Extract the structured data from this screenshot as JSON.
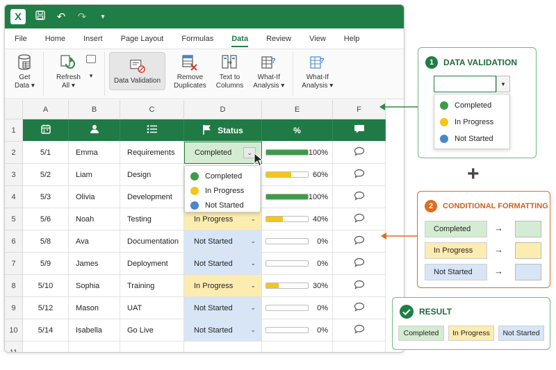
{
  "ribbon_tabs": [
    "File",
    "Home",
    "Insert",
    "Page Layout",
    "Formulas",
    "Data",
    "Review",
    "View",
    "Help"
  ],
  "active_tab": "Data",
  "ribbon": {
    "get_data": [
      "Get",
      "Data"
    ],
    "refresh": [
      "Refresh",
      "All"
    ],
    "data_validation": "Data Validation",
    "remove_duplicates": [
      "Remove",
      "Duplicates"
    ],
    "text_to_columns": [
      "Text to",
      "Columns"
    ],
    "whatif1": [
      "What-If",
      "Analysis"
    ],
    "whatif2": [
      "What-If",
      "Analysis"
    ]
  },
  "columns": [
    "A",
    "B",
    "C",
    "D",
    "E",
    "F"
  ],
  "rows": [
    "1",
    "2",
    "3",
    "4",
    "5",
    "6",
    "7",
    "8",
    "9",
    "10",
    "11"
  ],
  "header": {
    "status": "Status",
    "percent": "%"
  },
  "table": [
    {
      "date": "5/1",
      "name": "Emma",
      "task": "Requirements",
      "status": "Completed",
      "pct": 100,
      "pct_label": "100%"
    },
    {
      "date": "5/2",
      "name": "Liam",
      "task": "Design",
      "status": "",
      "pct": 60,
      "pct_label": "60%"
    },
    {
      "date": "5/3",
      "name": "Olivia",
      "task": "Development",
      "status": "",
      "pct": 100,
      "pct_label": "100%"
    },
    {
      "date": "5/6",
      "name": "Noah",
      "task": "Testing",
      "status": "In Progress",
      "pct": 40,
      "pct_label": "40%"
    },
    {
      "date": "5/8",
      "name": "Ava",
      "task": "Documentation",
      "status": "Not Started",
      "pct": 0,
      "pct_label": "0%"
    },
    {
      "date": "5/9",
      "name": "James",
      "task": "Deployment",
      "status": "Not Started",
      "pct": 0,
      "pct_label": "0%"
    },
    {
      "date": "5/10",
      "name": "Sophia",
      "task": "Training",
      "status": "In Progress",
      "pct": 30,
      "pct_label": "30%"
    },
    {
      "date": "5/12",
      "name": "Mason",
      "task": "UAT",
      "status": "Not Started",
      "pct": 0,
      "pct_label": "0%"
    },
    {
      "date": "5/14",
      "name": "Isabella",
      "task": "Go Live",
      "status": "Not Started",
      "pct": 0,
      "pct_label": "0%"
    }
  ],
  "dropdown_options": [
    "Completed",
    "In Progress",
    "Not Started"
  ],
  "panels": {
    "validation": {
      "num": "1",
      "title": "DATA VALIDATION"
    },
    "formatting": {
      "num": "2",
      "title": "CONDITIONAL FORMATTING",
      "arrow": "→"
    },
    "result": {
      "title": "RESULT"
    },
    "plus": "+"
  },
  "colors": {
    "excel_green": "#1e7e45",
    "completed_bg": "#d4ecd2",
    "progress_bg": "#fdecb0",
    "notstarted_bg": "#d7e5f7",
    "dot_completed": "#3f9a4a",
    "dot_progress": "#f5c518",
    "dot_notstarted": "#4a86c8",
    "bar_green": "#3f9a4a",
    "bar_yellow": "#f5c518",
    "orange": "#e06b1f"
  }
}
